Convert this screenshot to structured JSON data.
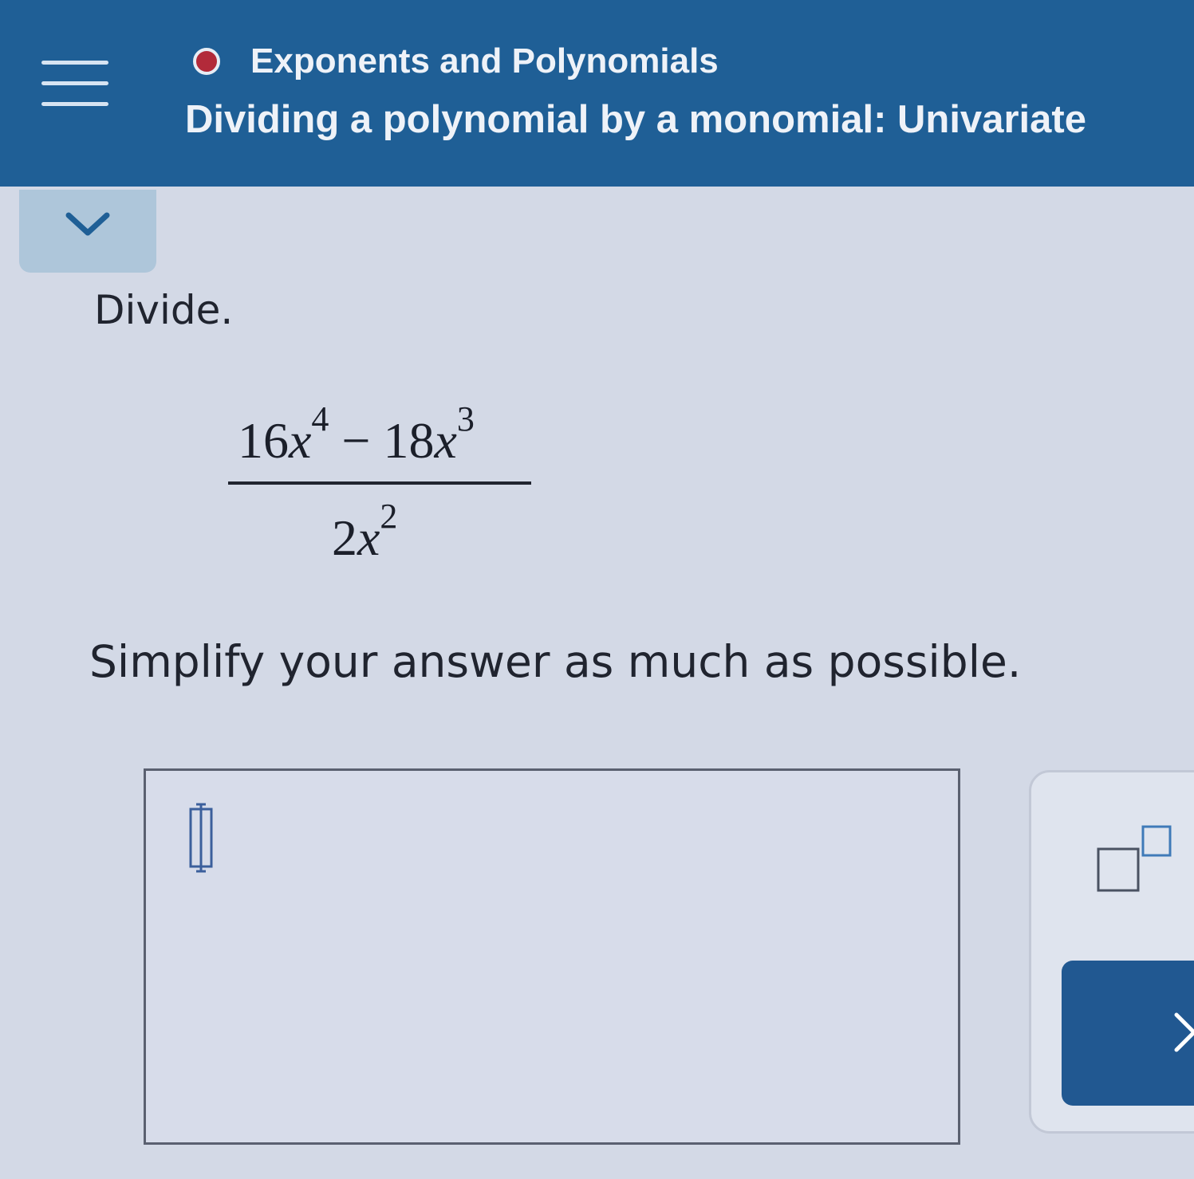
{
  "header": {
    "menu_icon": "hamburger-menu-icon",
    "status_color": "#b22a3a",
    "topic": "Exponents and Polynomials",
    "subtopic": "Dividing a polynomial by a monomial: Univariate"
  },
  "collapse": {
    "icon": "chevron-down-icon"
  },
  "problem": {
    "instruction": "Divide.",
    "numerator": {
      "term1_coef": "16",
      "term1_var": "x",
      "term1_exp": "4",
      "operator": "−",
      "term2_coef": "18",
      "term2_var": "x",
      "term2_exp": "3"
    },
    "denominator": {
      "coef": "2",
      "var": "x",
      "exp": "2"
    },
    "directions": "Simplify your answer as much as possible."
  },
  "answer": {
    "value": "",
    "cursor_icon": "answer-placeholder-cursor-icon"
  },
  "keypad": {
    "exponent_icon": "exponent-template-icon",
    "clear_icon": "clear-x-icon"
  },
  "colors": {
    "header_bg": "#1f5f96",
    "page_bg": "#d3d9e6",
    "clear_button_bg": "#215891"
  }
}
